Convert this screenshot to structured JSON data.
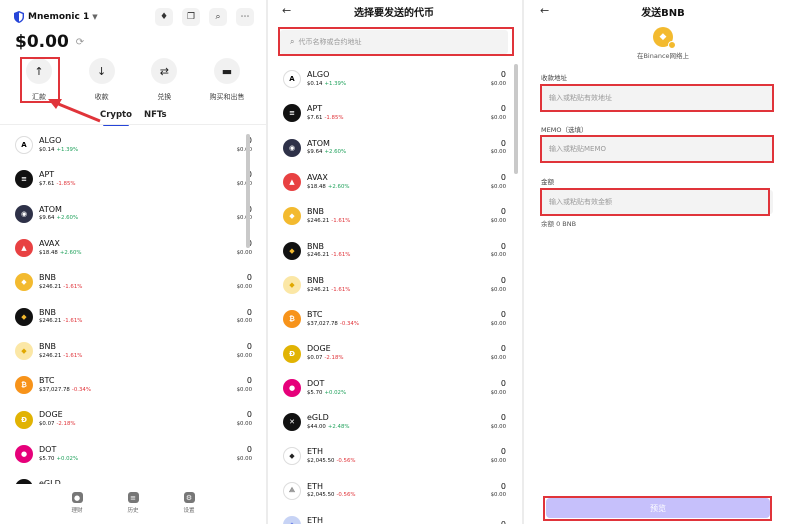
{
  "panel1": {
    "wallet_name": "Mnemonic 1",
    "header_icons": [
      "ethereum-icon",
      "copy-icon",
      "search-icon",
      "more-icon"
    ],
    "balance": "$0.00",
    "actions": [
      {
        "label": "汇款",
        "icon": "↑",
        "name": "send-action-button"
      },
      {
        "label": "收款",
        "icon": "↓",
        "name": "receive-action-button"
      },
      {
        "label": "兑换",
        "icon": "⇄",
        "name": "swap-action-button"
      },
      {
        "label": "购买和出售",
        "icon": "▬",
        "name": "buy-sell-action-button"
      }
    ],
    "tabs": [
      "Crypto",
      "NFTs"
    ],
    "coins": [
      {
        "sym": "ALGO",
        "price": "$0.14",
        "chg": "+1.39%",
        "dir": "up",
        "amt": "0",
        "usd": "$0.00",
        "color": "#ffffff",
        "glyph": "A",
        "fg": "#000"
      },
      {
        "sym": "APT",
        "price": "$7.61",
        "chg": "-1.85%",
        "dir": "down",
        "amt": "0",
        "usd": "$0.00",
        "color": "#111111",
        "glyph": "≡",
        "fg": "#fff"
      },
      {
        "sym": "ATOM",
        "price": "$9.64",
        "chg": "+2.60%",
        "dir": "up",
        "amt": "0",
        "usd": "$0.00",
        "color": "#2e3148",
        "glyph": "◉",
        "fg": "#fff"
      },
      {
        "sym": "AVAX",
        "price": "$18.48",
        "chg": "+2.60%",
        "dir": "up",
        "amt": "0",
        "usd": "$0.00",
        "color": "#e84142",
        "glyph": "▲",
        "fg": "#fff"
      },
      {
        "sym": "BNB",
        "price": "$246.21",
        "chg": "-1.61%",
        "dir": "down",
        "amt": "0",
        "usd": "$0.00",
        "color": "#f3ba2f",
        "glyph": "◆",
        "fg": "#fff"
      },
      {
        "sym": "BNB",
        "price": "$246.21",
        "chg": "-1.61%",
        "dir": "down",
        "amt": "0",
        "usd": "$0.00",
        "color": "#111111",
        "glyph": "◆",
        "fg": "#f3ba2f"
      },
      {
        "sym": "BNB",
        "price": "$246.21",
        "chg": "-1.61%",
        "dir": "down",
        "amt": "0",
        "usd": "$0.00",
        "color": "#fbe7a6",
        "glyph": "◆",
        "fg": "#e0a800"
      },
      {
        "sym": "BTC",
        "price": "$37,027.78",
        "chg": "-0.34%",
        "dir": "down",
        "amt": "0",
        "usd": "$0.00",
        "color": "#f7931a",
        "glyph": "₿",
        "fg": "#fff"
      },
      {
        "sym": "DOGE",
        "price": "$0.07",
        "chg": "-2.18%",
        "dir": "down",
        "amt": "0",
        "usd": "$0.00",
        "color": "#e1b303",
        "glyph": "Ð",
        "fg": "#fff"
      },
      {
        "sym": "DOT",
        "price": "$5.70",
        "chg": "+0.02%",
        "dir": "up",
        "amt": "0",
        "usd": "$0.00",
        "color": "#e6007a",
        "glyph": "●",
        "fg": "#fff"
      },
      {
        "sym": "eGLD",
        "price": "",
        "chg": "",
        "dir": "up",
        "amt": "0",
        "usd": "",
        "color": "#111111",
        "glyph": "✕",
        "fg": "#fff"
      }
    ],
    "nav": [
      {
        "label": "理财",
        "icon": "●"
      },
      {
        "label": "历史",
        "icon": "≡"
      },
      {
        "label": "设置",
        "icon": "⚙"
      }
    ]
  },
  "panel2": {
    "title": "选择要发送的代币",
    "search_placeholder": "代币名称或合约地址",
    "coins": [
      {
        "sym": "ALGO",
        "price": "$0.14",
        "chg": "+1.39%",
        "dir": "up",
        "amt": "0",
        "usd": "$0.00",
        "color": "#ffffff",
        "glyph": "A",
        "fg": "#000"
      },
      {
        "sym": "APT",
        "price": "$7.61",
        "chg": "-1.85%",
        "dir": "down",
        "amt": "0",
        "usd": "$0.00",
        "color": "#111111",
        "glyph": "≡",
        "fg": "#fff"
      },
      {
        "sym": "ATOM",
        "price": "$9.64",
        "chg": "+2.60%",
        "dir": "up",
        "amt": "0",
        "usd": "$0.00",
        "color": "#2e3148",
        "glyph": "◉",
        "fg": "#fff"
      },
      {
        "sym": "AVAX",
        "price": "$18.48",
        "chg": "+2.60%",
        "dir": "up",
        "amt": "0",
        "usd": "$0.00",
        "color": "#e84142",
        "glyph": "▲",
        "fg": "#fff"
      },
      {
        "sym": "BNB",
        "price": "$246.21",
        "chg": "-1.61%",
        "dir": "down",
        "amt": "0",
        "usd": "$0.00",
        "color": "#f3ba2f",
        "glyph": "◆",
        "fg": "#fff"
      },
      {
        "sym": "BNB",
        "price": "$246.21",
        "chg": "-1.61%",
        "dir": "down",
        "amt": "0",
        "usd": "$0.00",
        "color": "#111111",
        "glyph": "◆",
        "fg": "#f3ba2f"
      },
      {
        "sym": "BNB",
        "price": "$246.21",
        "chg": "-1.61%",
        "dir": "down",
        "amt": "0",
        "usd": "$0.00",
        "color": "#fbe7a6",
        "glyph": "◆",
        "fg": "#e0a800"
      },
      {
        "sym": "BTC",
        "price": "$37,027.78",
        "chg": "-0.34%",
        "dir": "down",
        "amt": "0",
        "usd": "$0.00",
        "color": "#f7931a",
        "glyph": "₿",
        "fg": "#fff"
      },
      {
        "sym": "DOGE",
        "price": "$0.07",
        "chg": "-2.18%",
        "dir": "down",
        "amt": "0",
        "usd": "$0.00",
        "color": "#e1b303",
        "glyph": "Ð",
        "fg": "#fff"
      },
      {
        "sym": "DOT",
        "price": "$5.70",
        "chg": "+0.02%",
        "dir": "up",
        "amt": "0",
        "usd": "$0.00",
        "color": "#e6007a",
        "glyph": "●",
        "fg": "#fff"
      },
      {
        "sym": "eGLD",
        "price": "$44.00",
        "chg": "+2.48%",
        "dir": "up",
        "amt": "0",
        "usd": "$0.00",
        "color": "#111111",
        "glyph": "✕",
        "fg": "#fff"
      },
      {
        "sym": "ETH",
        "price": "$2,045.50",
        "chg": "-0.56%",
        "dir": "down",
        "amt": "0",
        "usd": "$0.00",
        "color": "#ffffff",
        "glyph": "◆",
        "fg": "#222"
      },
      {
        "sym": "ETH",
        "price": "$2,045.50",
        "chg": "-0.56%",
        "dir": "down",
        "amt": "0",
        "usd": "$0.00",
        "color": "#ffffff",
        "glyph": "⟁",
        "fg": "#888"
      },
      {
        "sym": "ETH",
        "price": "",
        "chg": "",
        "dir": "up",
        "amt": "0",
        "usd": "",
        "color": "#c7d3f5",
        "glyph": "◆",
        "fg": "#6a7ee8"
      }
    ]
  },
  "panel3": {
    "title": "发送BNB",
    "network": "在Binance网络上",
    "address_label": "收款地址",
    "address_placeholder": "输入或粘贴有效地址",
    "memo_label": "MEMO（选填）",
    "memo_placeholder": "输入或粘贴MEMO",
    "amount_label": "金额",
    "amount_placeholder": "输入或粘贴有效金额",
    "remaining": "余额 0 BNB",
    "preview_label": "预览"
  },
  "colors": {
    "highlight": "#e0343a",
    "accent": "#2645d8",
    "up": "#1fa15b",
    "down": "#e0343a",
    "preview": "#c6c0fb"
  }
}
